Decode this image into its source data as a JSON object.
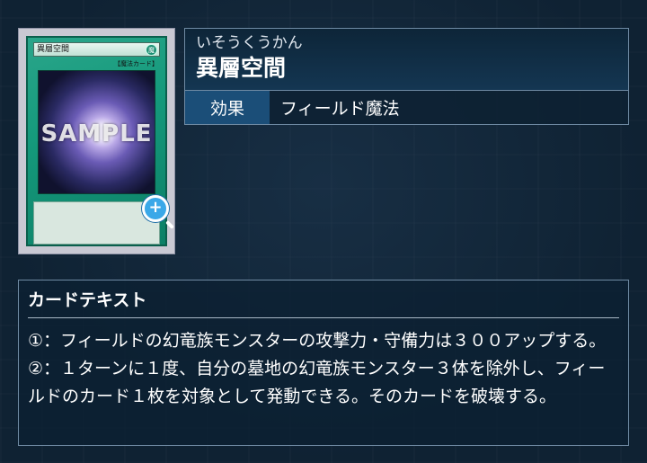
{
  "card": {
    "thumb_name": "異層空間",
    "attribute_glyph": "魔",
    "type_line": "【魔法カード】",
    "sample_watermark": "SAMPLE"
  },
  "info": {
    "ruby": "いそうくうかん",
    "name": "異層空間",
    "attr_label": "効果",
    "attr_value": "フィールド魔法"
  },
  "text_section": {
    "heading": "カードテキスト",
    "body": "①：フィールドの幻竜族モンスターの攻撃力・守備力は３００アップする。②：１ターンに１度、自分の墓地の幻竜族モンスター３体を除外し、フィールドのカード１枚を対象として発動できる。そのカードを破壊する。"
  },
  "icons": {
    "zoom": "zoom-in-icon"
  },
  "colors": {
    "background": "#0f2233",
    "label_bg": "#1b4e78",
    "spell_card": "#159a7c",
    "zoom_button": "#3aa8e8"
  }
}
